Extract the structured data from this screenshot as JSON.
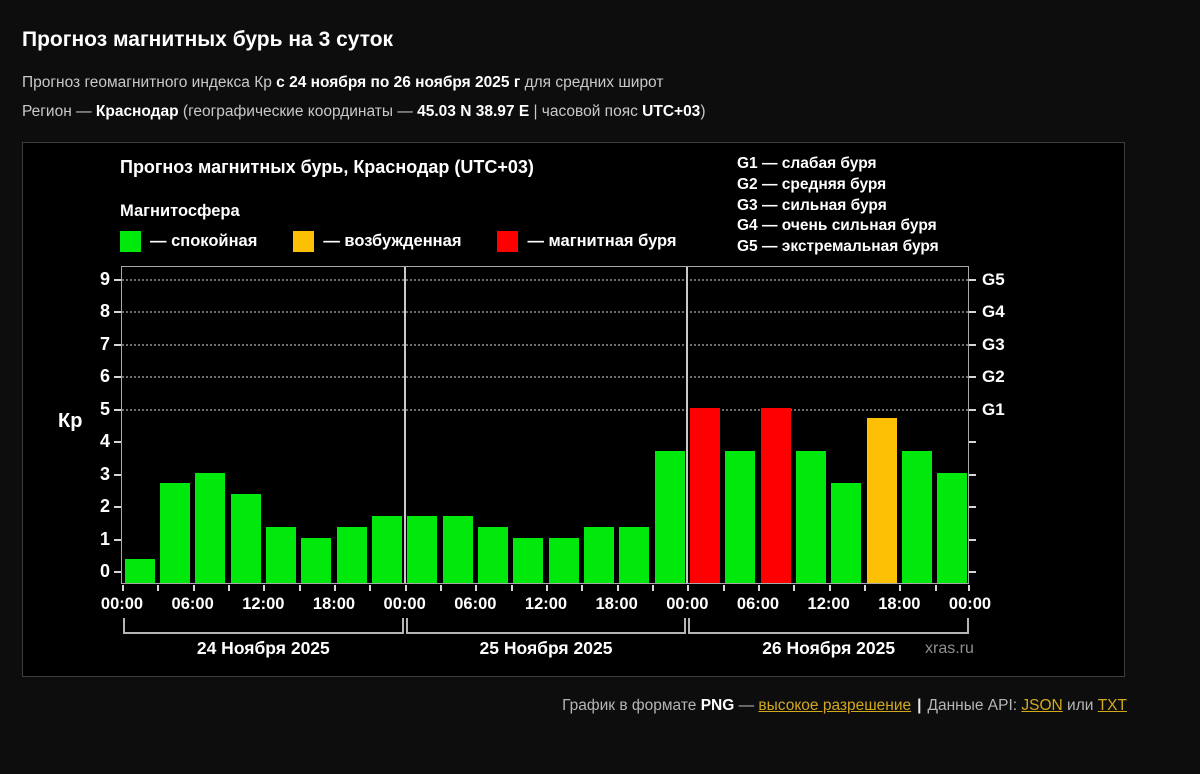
{
  "page": {
    "title": "Прогноз магнитных бурь на 3 суток",
    "subtitle_pre": "Прогноз геомагнитного индекса Кр ",
    "subtitle_bold": "с 24 ноября по 26 ноября 2025 г",
    "subtitle_post": " для средних широт",
    "region_pre": "Регион — ",
    "region_name": "Краснодар",
    "region_mid": " (географические координаты — ",
    "region_coords": "45.03 N 38.97 E",
    "region_mid2": " | часовой пояс ",
    "region_tz": "UTC+03",
    "region_post": ")"
  },
  "chart": {
    "title": "Прогноз магнитных бурь, Краснодар (UTC+03)",
    "legend_title": "Магнитосфера",
    "legend": [
      {
        "name": "quiet",
        "label": "— спокойная",
        "color": "#00e80c"
      },
      {
        "name": "excited",
        "label": "— возбужденная",
        "color": "#fdc004"
      },
      {
        "name": "storm",
        "label": "— магнитная буря",
        "color": "#fe0000"
      }
    ],
    "g_legend": [
      "G1 — слабая буря",
      "G2 — средняя буря",
      "G3 — сильная буря",
      "G4 — очень сильная буря",
      "G5 — экстремальная буря"
    ],
    "watermark": "xras.ru"
  },
  "chart_data": {
    "type": "bar",
    "ylabel": "Кр",
    "ylim": [
      0,
      9
    ],
    "yticks": [
      0,
      1,
      2,
      3,
      4,
      5,
      6,
      7,
      8,
      9
    ],
    "grid_levels": [
      5,
      6,
      7,
      8,
      9
    ],
    "right_axis_labels": [
      {
        "value": 5,
        "label": "G1"
      },
      {
        "value": 6,
        "label": "G2"
      },
      {
        "value": 7,
        "label": "G3"
      },
      {
        "value": 8,
        "label": "G4"
      },
      {
        "value": 9,
        "label": "G5"
      }
    ],
    "x_tick_labels": [
      "00:00",
      "06:00",
      "12:00",
      "18:00",
      "00:00",
      "06:00",
      "12:00",
      "18:00",
      "00:00",
      "06:00",
      "12:00",
      "18:00",
      "00:00"
    ],
    "hours_per_bar": 3,
    "thresholds": {
      "excited_min": 4,
      "storm_min": 5
    },
    "days": [
      {
        "date": "24 Ноября 2025",
        "values": [
          0.33,
          2.67,
          3.0,
          2.33,
          1.33,
          1.0,
          1.33,
          1.67
        ]
      },
      {
        "date": "25 Ноября 2025",
        "values": [
          1.67,
          1.67,
          1.33,
          1.0,
          1.0,
          1.33,
          1.33,
          3.67
        ]
      },
      {
        "date": "26 Ноября 2025",
        "values": [
          5.0,
          3.67,
          5.0,
          3.67,
          2.67,
          4.67,
          3.67,
          3.0
        ]
      }
    ]
  },
  "footer": {
    "text1": "График в формате ",
    "png": "PNG",
    "dash": " — ",
    "link_highres": "высокое разрешение",
    "sep": "|",
    "text2": "Данные API: ",
    "link_json": "JSON",
    "or_text": " или ",
    "link_txt": "TXT"
  }
}
